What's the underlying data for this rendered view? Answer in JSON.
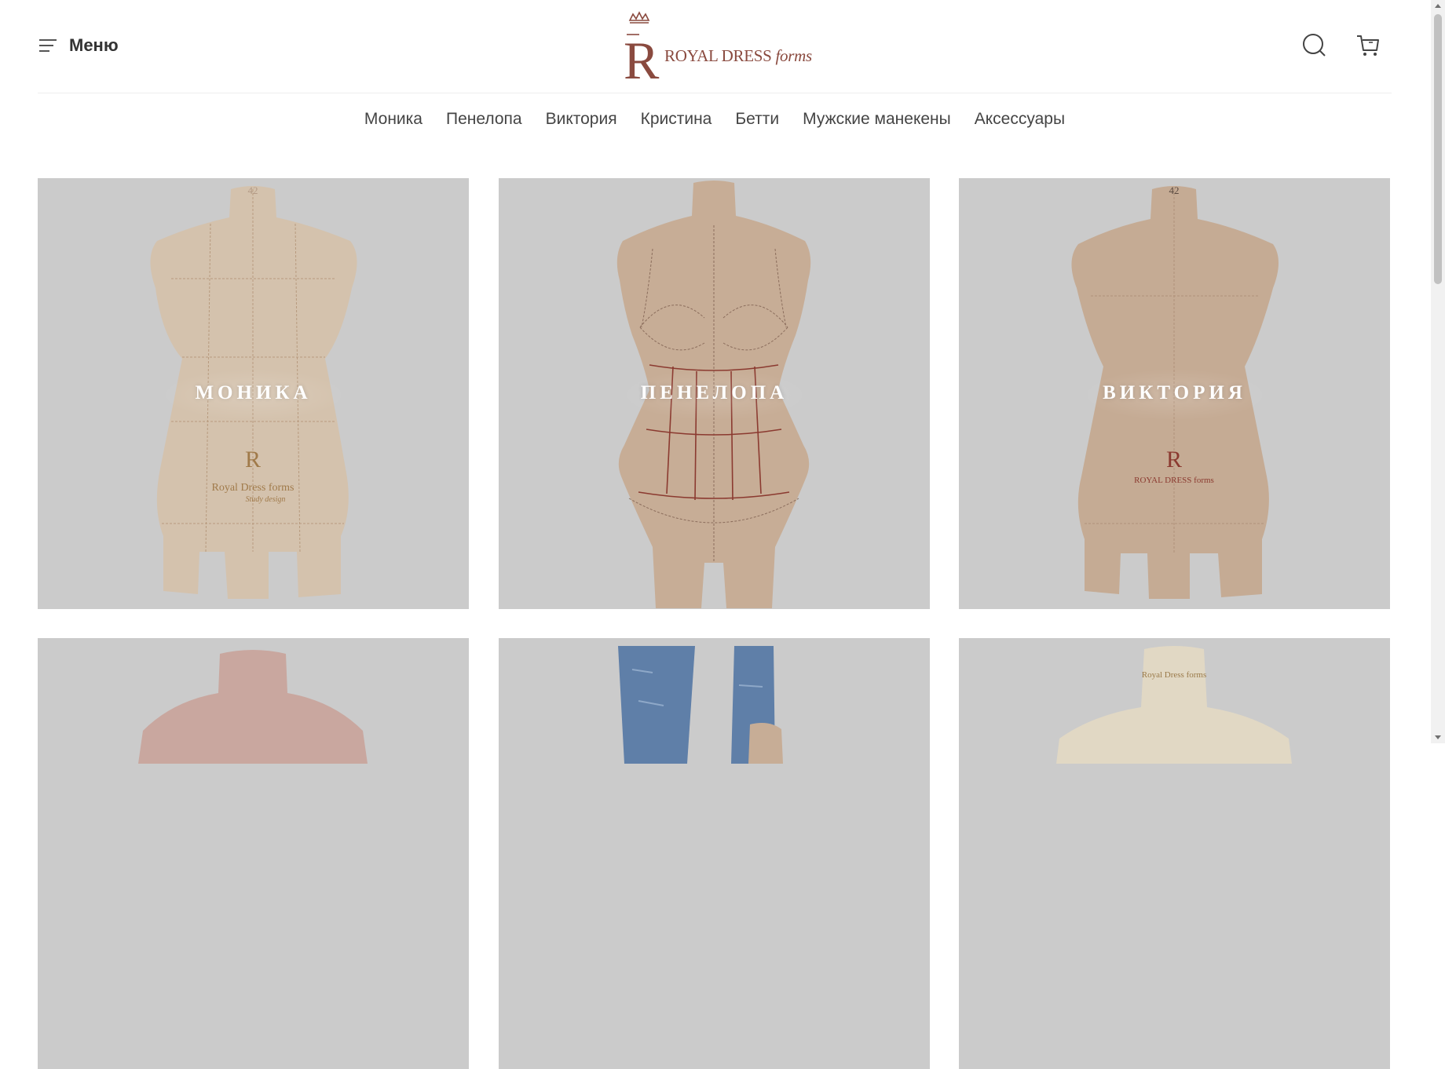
{
  "header": {
    "menu_label": "Меню",
    "logo_mark": "R",
    "logo_text_main": "ROYAL DRESS",
    "logo_text_italic": "forms",
    "icons": [
      "hamburger-icon",
      "search-icon",
      "cart-icon",
      "crown-icon"
    ]
  },
  "nav": {
    "items": [
      "Моника",
      "Пенелопа",
      "Виктория",
      "Кристина",
      "Бетти",
      "Мужские манекены",
      "Аксессуары"
    ]
  },
  "cards": [
    {
      "label": "МОНИКА",
      "neck_tag": "42",
      "brand_print": "Royal Dress forms",
      "brand_print_sub": "Study design"
    },
    {
      "label": "ПЕНЕЛОПА"
    },
    {
      "label": "ВИКТОРИЯ",
      "neck_tag": "42",
      "brand_print": "ROYAL DRESS forms"
    },
    {
      "label": ""
    },
    {
      "label": ""
    },
    {
      "label": "",
      "brand_print": "Royal Dress forms"
    }
  ],
  "colors": {
    "brand": "#8a4a3f",
    "card_bg": "#cbcbcb",
    "form_beige": "#d4c2ad",
    "form_skin": "#c7ad96",
    "form_pink": "#c9a79f",
    "seam_red": "#8b3a30"
  }
}
